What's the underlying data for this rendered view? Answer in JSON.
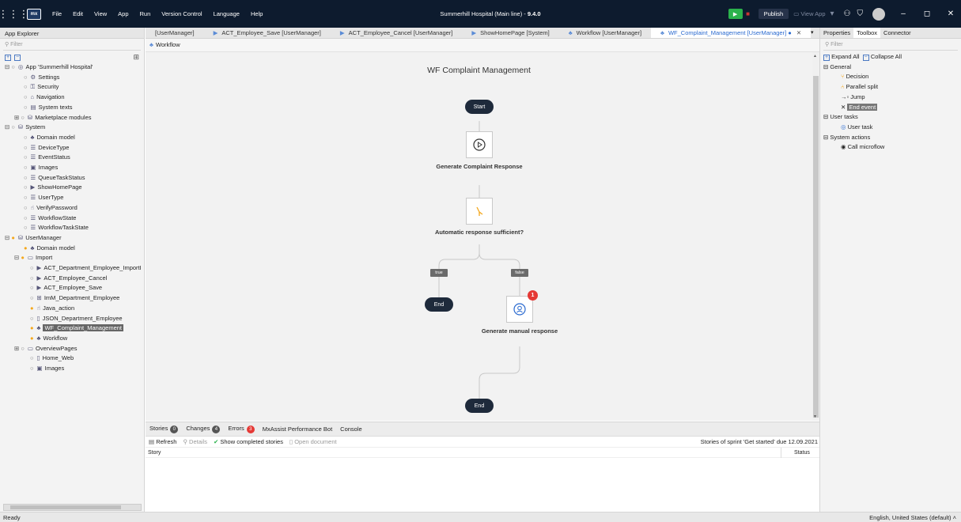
{
  "titlebar": {
    "logo": "mx",
    "menu": [
      "File",
      "Edit",
      "View",
      "App",
      "Run",
      "Version Control",
      "Language",
      "Help"
    ],
    "project_title": "Summerhill Hospital (Main line)",
    "version": "9.4.0",
    "publish_label": "Publish",
    "view_app_label": "View App"
  },
  "left_panel": {
    "header": "App Explorer",
    "filter_placeholder": "Filter",
    "tree": [
      {
        "label": "App 'Summerhill Hospital'",
        "level": 0,
        "icon": "◎",
        "marker": "circle",
        "exp": "⊟"
      },
      {
        "label": "Settings",
        "level": 1,
        "icon": "⚙",
        "marker": "circle"
      },
      {
        "label": "Security",
        "level": 1,
        "icon": "⚿",
        "marker": "circle"
      },
      {
        "label": "Navigation",
        "level": 1,
        "icon": "⌂",
        "marker": "circle"
      },
      {
        "label": "System texts",
        "level": 1,
        "icon": "▤",
        "marker": "circle"
      },
      {
        "label": "Marketplace modules",
        "level": 0,
        "icon": "⛁",
        "marker": "circle",
        "exp": "⊞",
        "indent": "ind3"
      },
      {
        "label": "System",
        "level": 0,
        "icon": "⛁",
        "marker": "circle",
        "exp": "⊟"
      },
      {
        "label": "Domain model",
        "level": 1,
        "icon": "♣",
        "marker": "circle"
      },
      {
        "label": "DeviceType",
        "level": 1,
        "icon": "☰",
        "marker": "circle"
      },
      {
        "label": "EventStatus",
        "level": 1,
        "icon": "☰",
        "marker": "circle"
      },
      {
        "label": "Images",
        "level": 1,
        "icon": "▣",
        "marker": "circle"
      },
      {
        "label": "QueueTaskStatus",
        "level": 1,
        "icon": "☰",
        "marker": "circle"
      },
      {
        "label": "ShowHomePage",
        "level": 1,
        "icon": "▶",
        "marker": "circle"
      },
      {
        "label": "UserType",
        "level": 1,
        "icon": "☰",
        "marker": "circle"
      },
      {
        "label": "VerifyPassword",
        "level": 1,
        "icon": "☝",
        "marker": "circle"
      },
      {
        "label": "WorkflowState",
        "level": 1,
        "icon": "☰",
        "marker": "circle"
      },
      {
        "label": "WorkflowTaskState",
        "level": 1,
        "icon": "☰",
        "marker": "circle"
      },
      {
        "label": "UserManager",
        "level": 0,
        "icon": "⛁",
        "marker": "dot",
        "exp": "⊟"
      },
      {
        "label": "Domain model",
        "level": 1,
        "icon": "♣",
        "marker": "dot"
      },
      {
        "label": "Import",
        "level": 1,
        "icon": "▭",
        "marker": "dot",
        "exp": "⊟",
        "indent": "ind3"
      },
      {
        "label": "ACT_Department_Employee_ImportI",
        "level": 2,
        "icon": "▶",
        "marker": "circle"
      },
      {
        "label": "ACT_Employee_Cancel",
        "level": 2,
        "icon": "▶",
        "marker": "circle"
      },
      {
        "label": "ACT_Employee_Save",
        "level": 2,
        "icon": "▶",
        "marker": "circle"
      },
      {
        "label": "ImM_Department_Employee",
        "level": 2,
        "icon": "⊞",
        "marker": "circle"
      },
      {
        "label": "Java_action",
        "level": 2,
        "icon": "☝",
        "marker": "dot"
      },
      {
        "label": "JSON_Department_Employee",
        "level": 2,
        "icon": "▯",
        "marker": "circle"
      },
      {
        "label": "WF_Complaint_Management",
        "level": 2,
        "icon": "♣",
        "marker": "dot",
        "selected": true
      },
      {
        "label": "Workflow",
        "level": 2,
        "icon": "♣",
        "marker": "dot"
      },
      {
        "label": "OverviewPages",
        "level": 1,
        "icon": "▭",
        "marker": "circle",
        "exp": "⊞",
        "indent": "ind3"
      },
      {
        "label": "Home_Web",
        "level": 2,
        "icon": "▯",
        "marker": "circle"
      },
      {
        "label": "Images",
        "level": 2,
        "icon": "▣",
        "marker": "circle"
      }
    ]
  },
  "tabs": [
    {
      "label": "[UserManager]",
      "icon": ""
    },
    {
      "label": "ACT_Employee_Save [UserManager]",
      "icon": "▶"
    },
    {
      "label": "ACT_Employee_Cancel [UserManager]",
      "icon": "▶"
    },
    {
      "label": "ShowHomePage [System]",
      "icon": "▶"
    },
    {
      "label": "Workflow [UserManager]",
      "icon": "♣"
    },
    {
      "label": "WF_Complaint_Management [UserManager] ●",
      "icon": "♣",
      "active": true
    }
  ],
  "breadcrumb": "Workflow",
  "workflow": {
    "title": "WF Complaint Management",
    "start": "Start",
    "task1": "Generate Complaint Response",
    "decision": "Automatic response sufficient?",
    "true_label": "true",
    "false_label": "false",
    "end_left": "End",
    "task2": "Generate manual response",
    "task2_badge": "1",
    "end_bottom": "End"
  },
  "bottom": {
    "tabs": [
      {
        "label": "Stories",
        "count": "0",
        "color": "#555"
      },
      {
        "label": "Changes",
        "count": "4",
        "color": "#555"
      },
      {
        "label": "Errors",
        "count": "3",
        "color": "#e53935"
      },
      {
        "label": "MxAssist Performance Bot",
        "count": ""
      },
      {
        "label": "Console",
        "count": ""
      }
    ],
    "refresh": "Refresh",
    "details": "Details",
    "show_completed": "Show completed stories",
    "open_document": "Open document",
    "sprint": "Stories of sprint 'Get started' due 12.09.2021",
    "col_story": "Story",
    "col_status": "Status"
  },
  "right_panel": {
    "tabs": [
      "Properties",
      "Toolbox",
      "Connector"
    ],
    "active_tab": "Toolbox",
    "filter_placeholder": "Filter",
    "expand_all": "Expand All",
    "collapse_all": "Collapse All",
    "general": "General",
    "decision": "Decision",
    "parallel_split": "Parallel split",
    "jump": "Jump",
    "end_event": "End event",
    "user_tasks": "User tasks",
    "user_task": "User task",
    "system_actions": "System actions",
    "call_microflow": "Call microflow"
  },
  "statusbar": {
    "left": "Ready",
    "right": "English, United States (default)"
  }
}
